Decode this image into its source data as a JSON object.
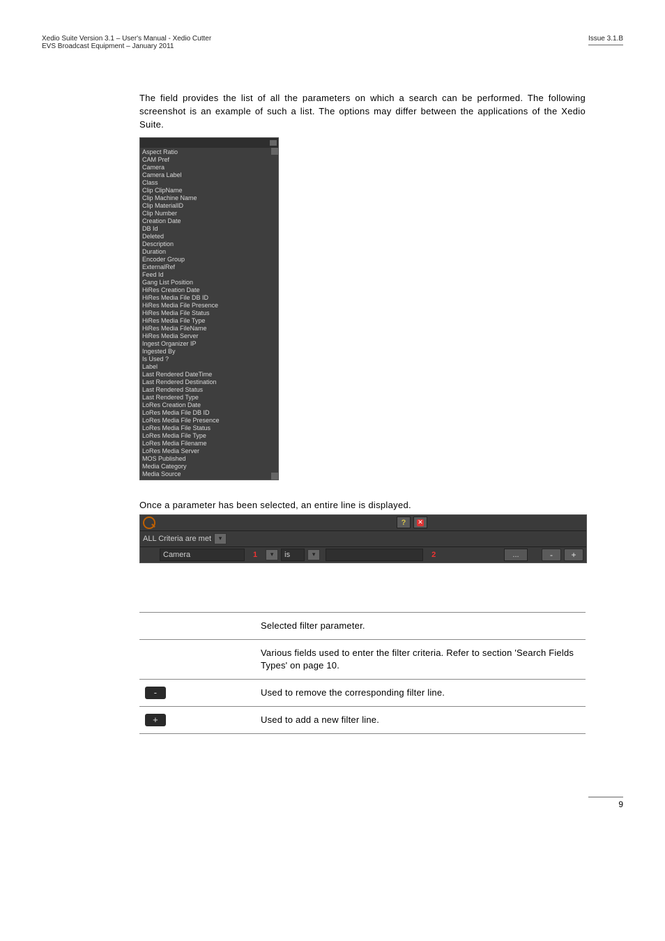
{
  "header": {
    "left_line1": "Xedio Suite Version 3.1 – User's Manual - Xedio Cutter",
    "left_line2": "EVS Broadcast Equipment – January 2011",
    "right": "Issue 3.1.B"
  },
  "intro_text": "The            field provides the list of all the parameters on which a search can be performed. The following screenshot is an example of such a list. The options may differ between the applications of the Xedio Suite.",
  "dropdown_items": [
    "Aspect Ratio",
    "CAM Pref",
    "Camera",
    "Camera Label",
    "Class",
    "Clip ClipName",
    "Clip Machine Name",
    "Clip MaterialID",
    "Clip Number",
    "Creation Date",
    "DB Id",
    "Deleted",
    "Description",
    "Duration",
    "Encoder Group",
    "ExternalRef",
    "Feed Id",
    "Gang List Position",
    "HiRes Creation Date",
    "HiRes Media File DB ID",
    "HiRes Media File Presence",
    "HiRes Media File Status",
    "HiRes Media File Type",
    "HiRes Media FileName",
    "HiRes Media Server",
    "Ingest Organizer IP",
    "Ingested By",
    "Is Used ?",
    "Label",
    "Last Rendered DateTime",
    "Last Rendered Destination",
    "Last Rendered Status",
    "Last Rendered Type",
    "LoRes Creation Date",
    "LoRes Media File DB ID",
    "LoRes Media File Presence",
    "LoRes Media File Status",
    "LoRes Media File Type",
    "LoRes Media Filename",
    "LoRes Media Server",
    "MOS Published",
    "Media Category",
    "Media Source"
  ],
  "caption_after_dropdown": "Once a parameter has been selected, an entire line is displayed.",
  "filterbar": {
    "help": "?",
    "close": "✕",
    "criteria_label": "ALL Criteria are met",
    "camera_label": "Camera",
    "num1": "1",
    "is_label": "is",
    "num2": "2",
    "dots": "...",
    "minus": "-",
    "plus": "+"
  },
  "table_rows": [
    {
      "icon": "",
      "desc": "Selected filter parameter."
    },
    {
      "icon": "",
      "desc": "Various fields used to enter the filter criteria. Refer to section 'Search Fields Types' on page 10."
    },
    {
      "icon": "-",
      "desc": "Used to remove the corresponding filter line."
    },
    {
      "icon": "+",
      "desc": "Used to add a new filter line."
    }
  ],
  "page_number": "9"
}
